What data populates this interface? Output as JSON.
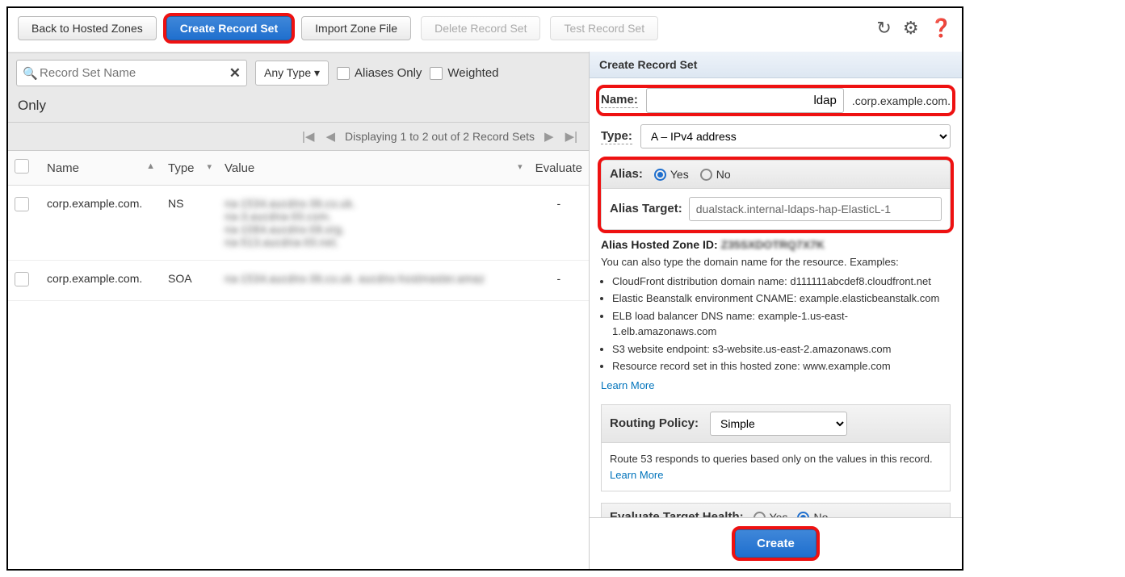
{
  "toolbar": {
    "back": "Back to Hosted Zones",
    "create": "Create Record Set",
    "import": "Import Zone File",
    "delete": "Delete Record Set",
    "test": "Test Record Set"
  },
  "filter": {
    "search_placeholder": "Record Set Name",
    "type_select": "Any Type",
    "aliases_only": "Aliases Only",
    "weighted": "Weighted",
    "only": "Only"
  },
  "pager": {
    "text": "Displaying 1 to 2 out of 2 Record Sets"
  },
  "table": {
    "cols": {
      "name": "Name",
      "type": "Type",
      "value": "Value",
      "evaluate": "Evaluate"
    },
    "rows": [
      {
        "name": "corp.example.com.",
        "type": "NS",
        "value_lines": [
          "na-1534.aucdns-36.co.uk.",
          "na-3.aucdna-00.com.",
          "na-1084.aucdns-08.org.",
          "na-513.aucdna-00.net."
        ],
        "evaluate": "-"
      },
      {
        "name": "corp.example.com.",
        "type": "SOA",
        "value_lines": [
          "na-1534.aucdns-36.co.uk. aucdns-hostmaster.amaz"
        ],
        "evaluate": "-"
      }
    ]
  },
  "right": {
    "title": "Create Record Set",
    "name_label": "Name:",
    "name_value": "ldap",
    "name_suffix": ".corp.example.com.",
    "type_label": "Type:",
    "type_value": "A – IPv4 address",
    "alias_label": "Alias:",
    "yes": "Yes",
    "no": "No",
    "alias_target_label": "Alias Target:",
    "alias_target_value": "dualstack.internal-ldaps-hap-ElasticL-1",
    "hosted_id_label": "Alias Hosted Zone ID:",
    "hosted_id_value": "Z35SXDOTRQ7X7K",
    "help_intro": "You can also type the domain name for the resource. Examples:",
    "help_items": [
      "CloudFront distribution domain name: d111111abcdef8.cloudfront.net",
      "Elastic Beanstalk environment CNAME: example.elasticbeanstalk.com",
      "ELB load balancer DNS name: example-1.us-east-1.elb.amazonaws.com",
      "S3 website endpoint: s3-website.us-east-2.amazonaws.com",
      "Resource record set in this hosted zone: www.example.com"
    ],
    "learn_more": "Learn More",
    "routing_label": "Routing Policy:",
    "routing_value": "Simple",
    "routing_help": "Route 53 responds to queries based only on the values in this record.",
    "eval_label": "Evaluate Target Health:",
    "create_btn": "Create"
  }
}
